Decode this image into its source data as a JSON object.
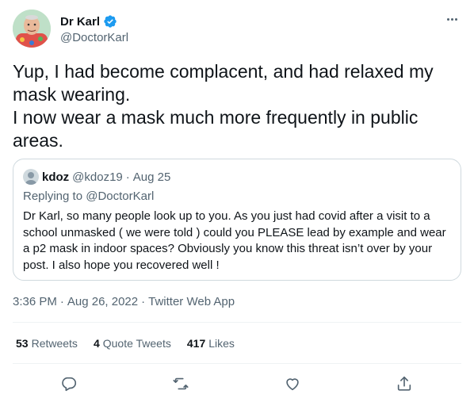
{
  "author": {
    "display_name": "Dr Karl",
    "handle": "@DoctorKarl",
    "verified": true
  },
  "tweet": {
    "text": "Yup, I had become complacent, and had relaxed my mask wearing.\nI now wear a mask much more frequently in public areas."
  },
  "quoted_tweet": {
    "display_name": "kdoz",
    "handle": "@kdoz19",
    "separator": "·",
    "date": "Aug 25",
    "replying_prefix": "Replying to",
    "replying_to": "@DoctorKarl",
    "text": "Dr Karl, so many people look up to you. As you just had covid after a visit to a school unmasked ( we were told ) could you PLEASE lead by example and wear a p2 mask in indoor spaces? Obviously you know this threat isn’t over by your post. I also hope you recovered well !"
  },
  "meta": {
    "time": "3:36 PM",
    "separator": "·",
    "date": "Aug 26, 2022",
    "app": "Twitter Web App"
  },
  "stats": {
    "retweets_count": "53",
    "retweets_label": "Retweets",
    "quotes_count": "4",
    "quotes_label": "Quote Tweets",
    "likes_count": "417",
    "likes_label": "Likes"
  },
  "colors": {
    "text_primary": "#0f1419",
    "text_secondary": "#536471",
    "verified_blue": "#1d9bf0",
    "border": "#cfd9de"
  },
  "icons": {
    "more": "more-horizontal-icon",
    "verified": "verified-badge-icon",
    "reply": "reply-icon",
    "retweet": "retweet-icon",
    "like": "like-heart-icon",
    "share": "share-icon"
  }
}
